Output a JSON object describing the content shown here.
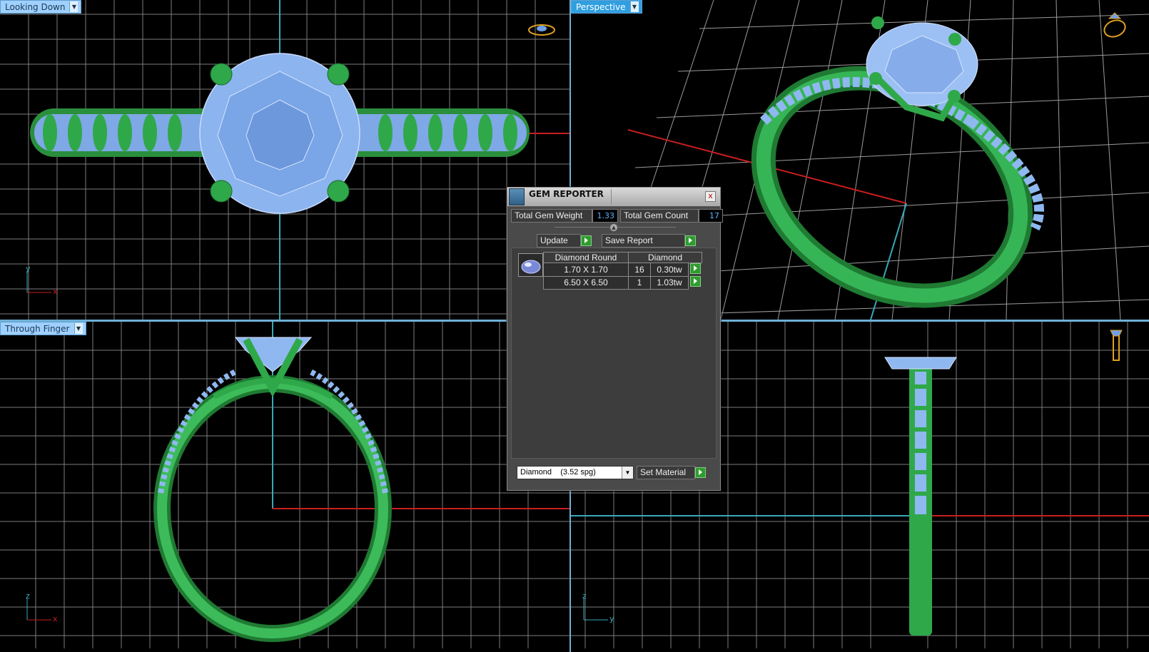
{
  "viewports": {
    "top_left": {
      "label": "Looking Down",
      "axis_h": "x",
      "axis_v": "y"
    },
    "top_right": {
      "label": "Perspective"
    },
    "bottom_left": {
      "label": "Through Finger",
      "axis_h": "x",
      "axis_v": "z"
    },
    "bottom_right": {
      "axis_h": "y",
      "axis_v": "z"
    }
  },
  "gem_reporter": {
    "title": "GEM REPORTER",
    "close": "x",
    "total_weight_label": "Total Gem Weight",
    "total_weight": "1.33",
    "total_count_label": "Total Gem Count",
    "total_count": "17",
    "update_label": "Update",
    "save_label": "Save Report",
    "table": {
      "headers": [
        "Diamond Round",
        "Diamond"
      ],
      "rows": [
        {
          "size": "1.70 X 1.70",
          "count": "16",
          "weight": "0.30tw"
        },
        {
          "size": "6.50 X 6.50",
          "count": "1",
          "weight": "1.03tw"
        }
      ]
    },
    "material_select": "Diamond    (3.52 spg)",
    "set_material_label": "Set Material"
  },
  "colors": {
    "metal": "#2fa84a",
    "gem": "#8fb8f0",
    "axis_red": "#c81e1e",
    "axis_cyan": "#3aa7b8",
    "grid": "#9a9a9a"
  }
}
